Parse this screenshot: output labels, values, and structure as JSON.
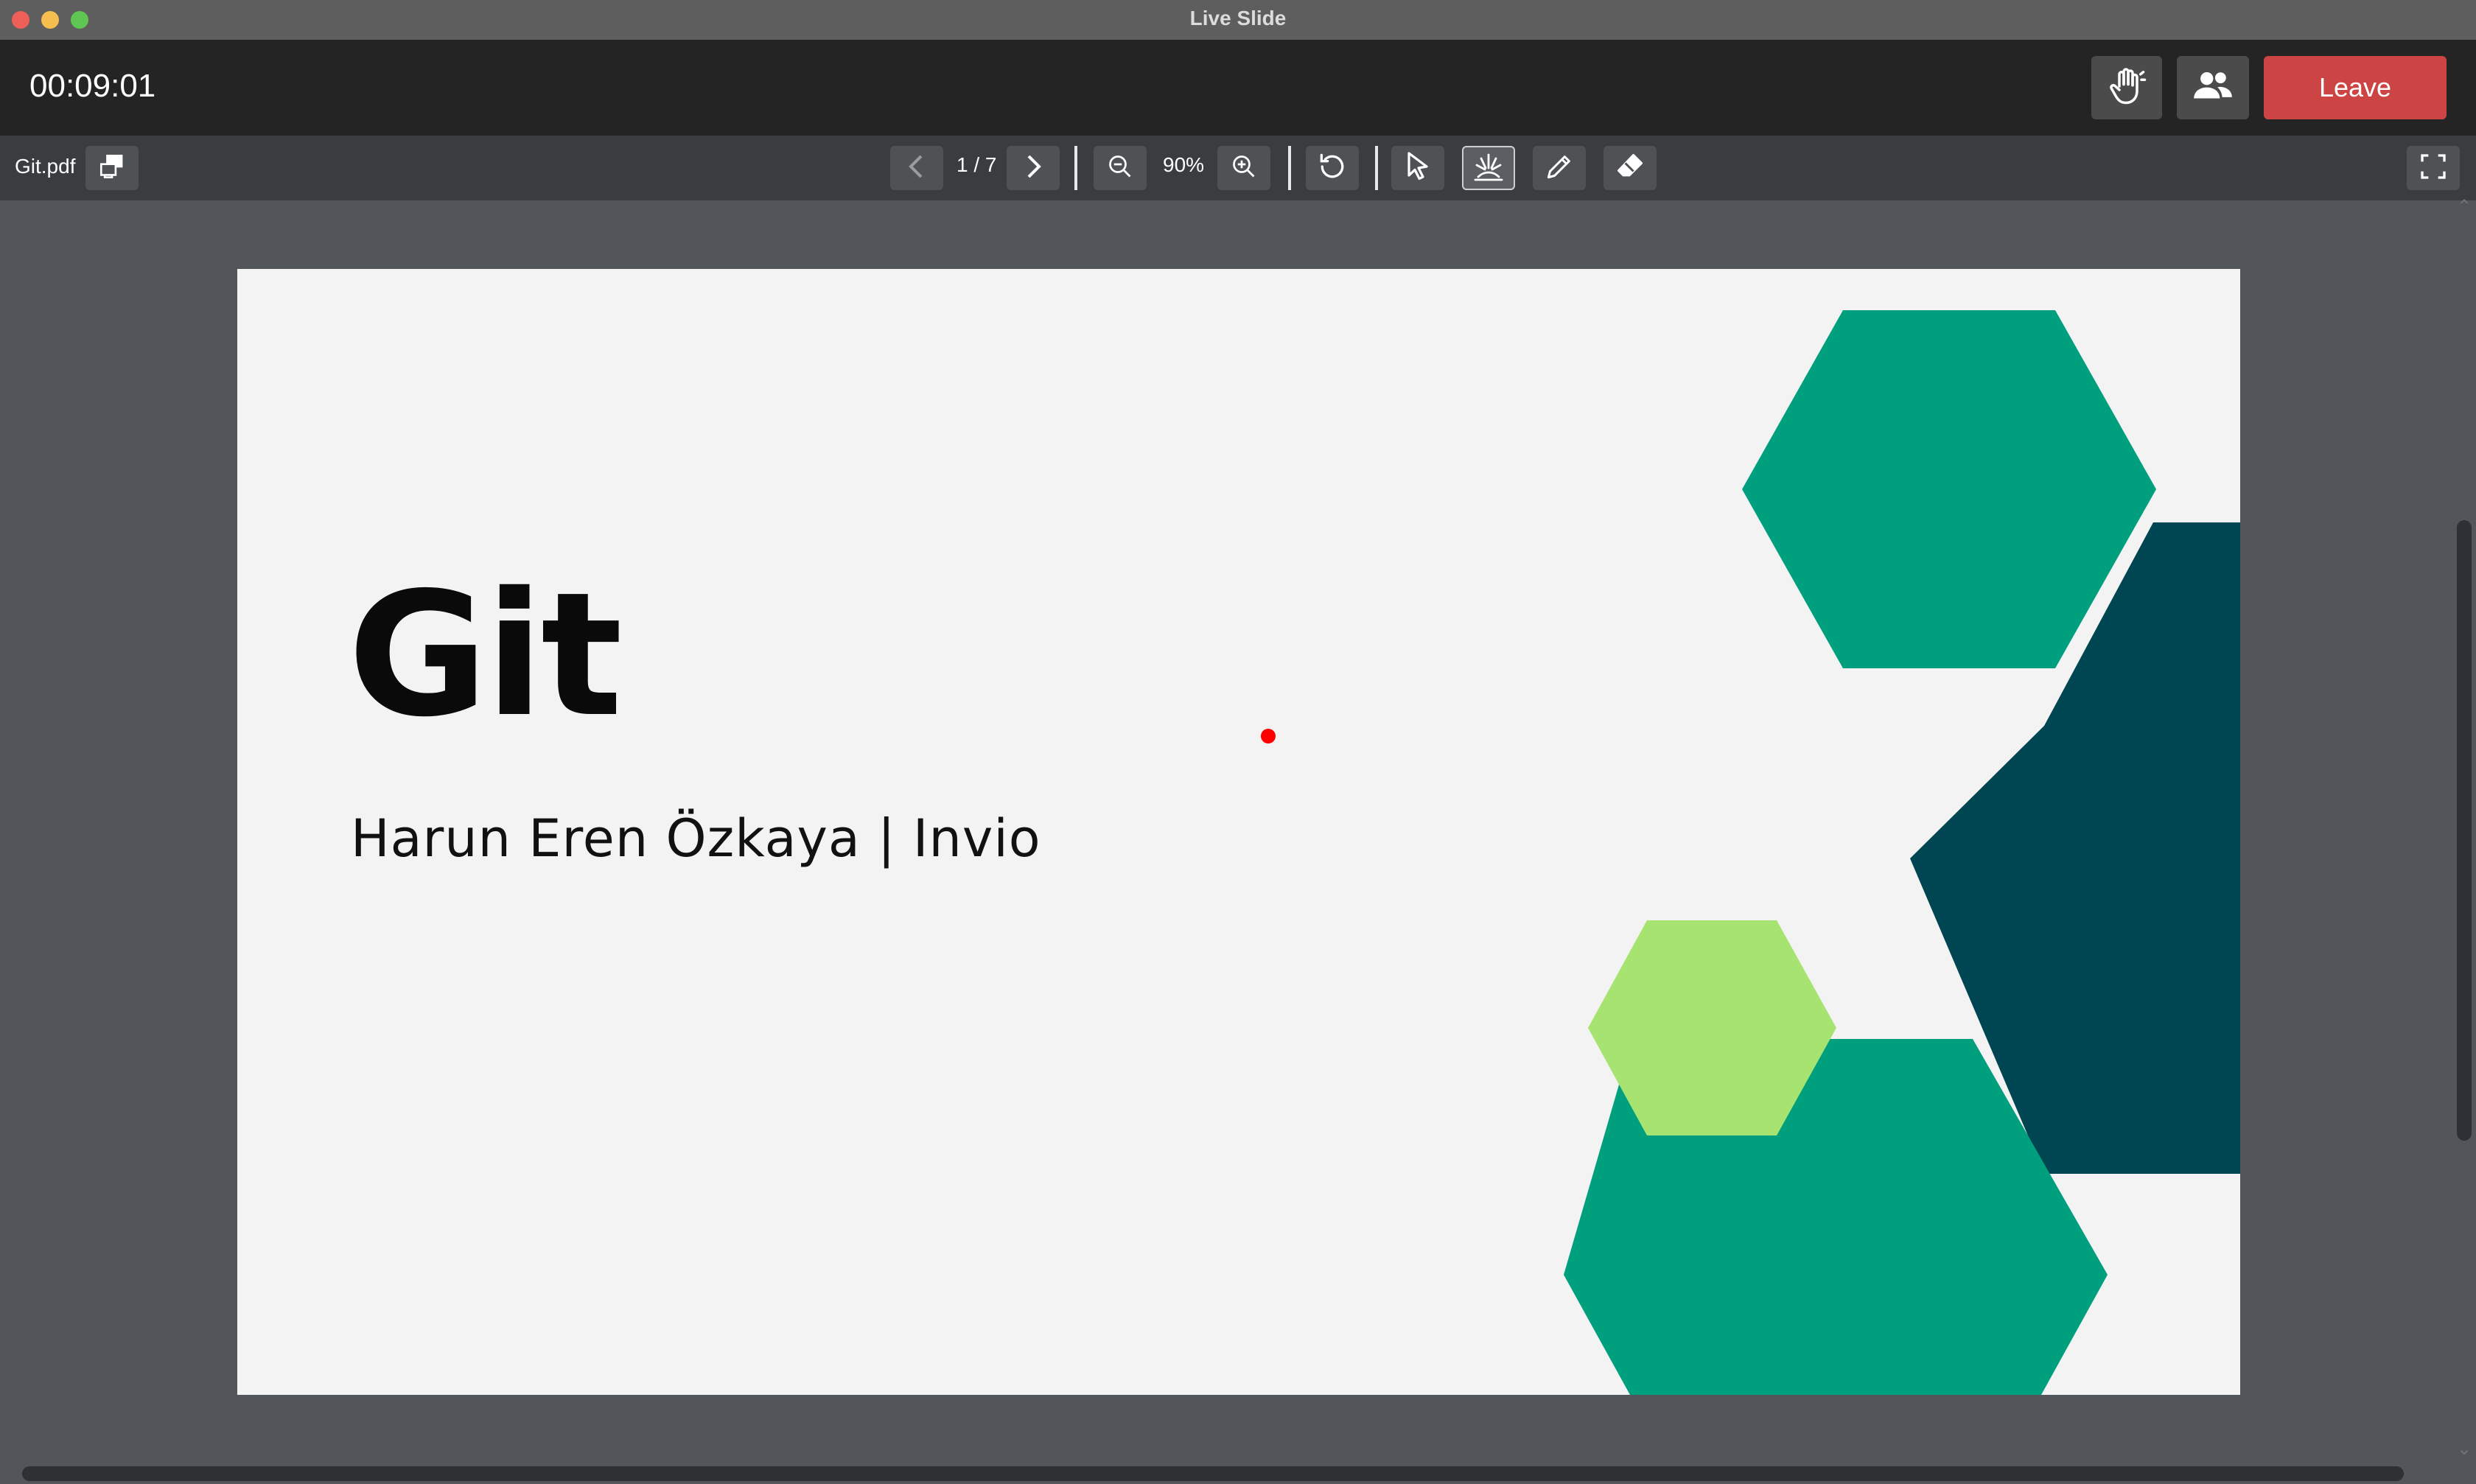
{
  "window": {
    "title": "Live Slide"
  },
  "session": {
    "timer": "00:09:01",
    "leave_label": "Leave"
  },
  "toolbar": {
    "filename": "Git.pdf",
    "page_indicator": "1 / 7",
    "zoom_level": "90%"
  },
  "slide": {
    "title": "Git",
    "subtitle": "Harun Eren Özkaya | Invio",
    "colors": {
      "background": "#f3f3f3",
      "teal": "#00a07f",
      "dark_teal": "#004652",
      "light_green": "#a6e371"
    }
  },
  "icons": {
    "raise_hand": "hand-icon",
    "participants": "people-icon",
    "share_screen": "screen-share-icon",
    "prev_page": "chevron-left-icon",
    "next_page": "chevron-right-icon",
    "zoom_out": "zoom-out-icon",
    "zoom_in": "zoom-in-icon",
    "reset": "rotate-icon",
    "select": "cursor-icon",
    "laser": "laser-pointer-icon",
    "pen": "pencil-icon",
    "eraser": "eraser-icon",
    "fullscreen": "fullscreen-icon"
  }
}
